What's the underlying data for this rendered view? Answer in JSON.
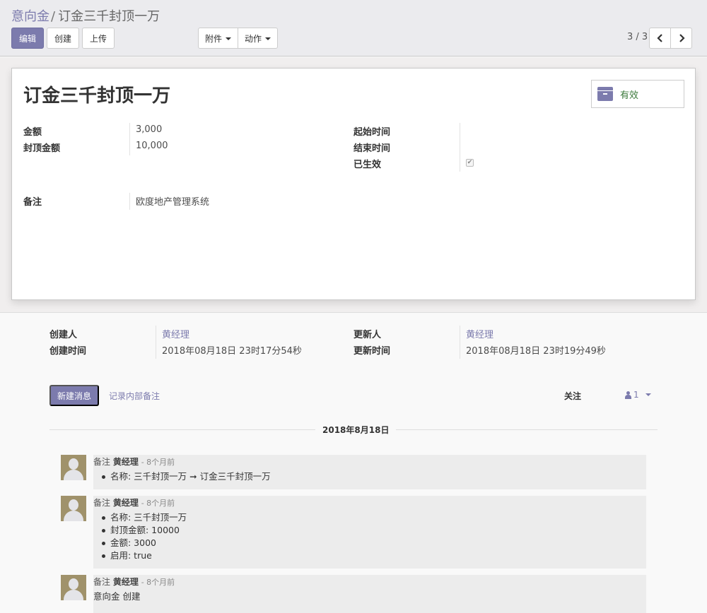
{
  "breadcrumb": {
    "parent": "意向金",
    "separator": "/",
    "current": "订金三千封顶一万"
  },
  "toolbar": {
    "edit": "编辑",
    "create": "创建",
    "upload": "上传",
    "attachment": "附件",
    "action": "动作"
  },
  "pager": {
    "value": "3 / 3"
  },
  "record": {
    "title": "订金三千封顶一万",
    "status": "有效",
    "fields_left": [
      {
        "label": "金额",
        "value": "3,000"
      },
      {
        "label": "封顶金额",
        "value": "10,000"
      }
    ],
    "fields_right": [
      {
        "label": "起始时间",
        "value": ""
      },
      {
        "label": "结束时间",
        "value": ""
      },
      {
        "label": "已生效",
        "value": ""
      }
    ],
    "active_checked": true,
    "note": {
      "label": "备注",
      "value": "欧度地产管理系统"
    }
  },
  "metadata": {
    "created_by_label": "创建人",
    "created_by": "黄经理",
    "created_on_label": "创建时间",
    "created_on": "2018年08月18日 23时17分54秒",
    "updated_by_label": "更新人",
    "updated_by": "黄经理",
    "updated_on_label": "更新时间",
    "updated_on": "2018年08月18日 23时19分49秒"
  },
  "chatter": {
    "new_message": "新建消息",
    "log_note": "记录内部备注",
    "follow": "关注",
    "followers_count": "1",
    "date": "2018年8月18日",
    "messages": [
      {
        "type": "备注",
        "author": "黄经理",
        "time": "- 8个月前",
        "items": [
          "名称: 三千封顶一万 ➞ 订金三千封顶一万"
        ]
      },
      {
        "type": "备注",
        "author": "黄经理",
        "time": "- 8个月前",
        "items": [
          "名称: 三千封顶一万",
          "封顶金额: 10000",
          "金额: 3000",
          "启用: true"
        ]
      },
      {
        "type": "备注",
        "author": "黄经理",
        "time": "- 8个月前",
        "body": "意向金 创建"
      }
    ]
  }
}
